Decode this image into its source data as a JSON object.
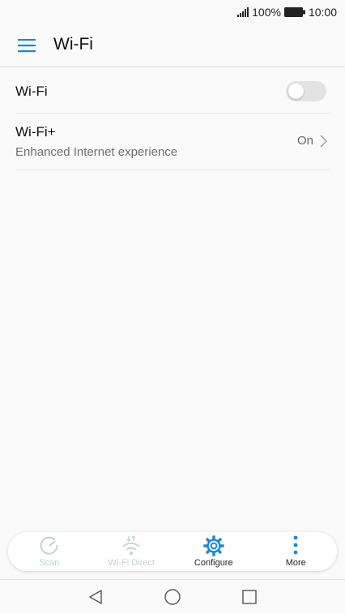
{
  "status_bar": {
    "battery_percent": "100%",
    "time": "10:00"
  },
  "app_bar": {
    "title": "Wi-Fi"
  },
  "settings": {
    "wifi": {
      "label": "Wi-Fi",
      "enabled": false
    },
    "wifi_plus": {
      "label": "Wi-Fi+",
      "subtitle": "Enhanced Internet experience",
      "value": "On"
    }
  },
  "bottom_bar": {
    "items": [
      {
        "label": "Scan",
        "icon": "scan-icon",
        "enabled": false
      },
      {
        "label": "Wi-Fi Direct",
        "icon": "wifi-direct-icon",
        "enabled": false
      },
      {
        "label": "Configure",
        "icon": "gear-icon",
        "enabled": true
      },
      {
        "label": "More",
        "icon": "more-vertical-icon",
        "enabled": true
      }
    ]
  },
  "colors": {
    "accent": "#1a87d6",
    "disabled": "#c4d0da",
    "toggle_off": "#e3e3e3"
  }
}
